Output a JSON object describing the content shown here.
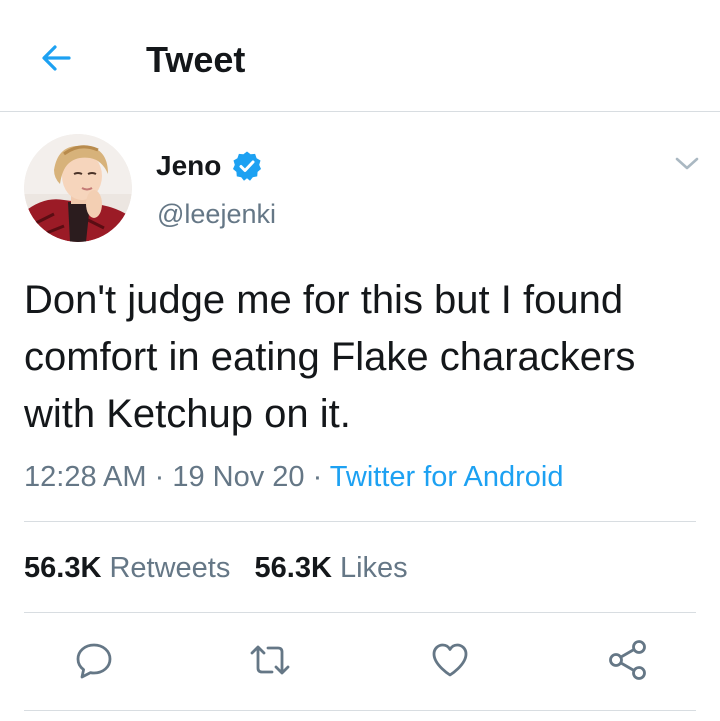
{
  "header": {
    "title": "Tweet",
    "back_icon": "arrow-left-icon"
  },
  "colors": {
    "accent": "#1da1f2",
    "text_primary": "#14171a",
    "text_secondary": "#657786",
    "divider": "#d8dde1",
    "verified_badge": "#1da1f2"
  },
  "tweet": {
    "author": {
      "display_name": "Jeno",
      "handle": "@leejenki",
      "verified": true,
      "avatar_icon": "user-avatar"
    },
    "text": "Don't judge me for this but I found comfort in eating Flake charackers with Ketchup on it.",
    "time": "12:28 AM",
    "separator": " · ",
    "date": "19 Nov 20",
    "source": "Twitter for Android"
  },
  "stats": {
    "retweets_count": "56.3K",
    "retweets_label": "Retweets",
    "likes_count": "56.3K",
    "likes_label": "Likes"
  },
  "actions": [
    {
      "name": "reply-icon"
    },
    {
      "name": "retweet-icon"
    },
    {
      "name": "like-icon"
    },
    {
      "name": "share-icon"
    }
  ]
}
